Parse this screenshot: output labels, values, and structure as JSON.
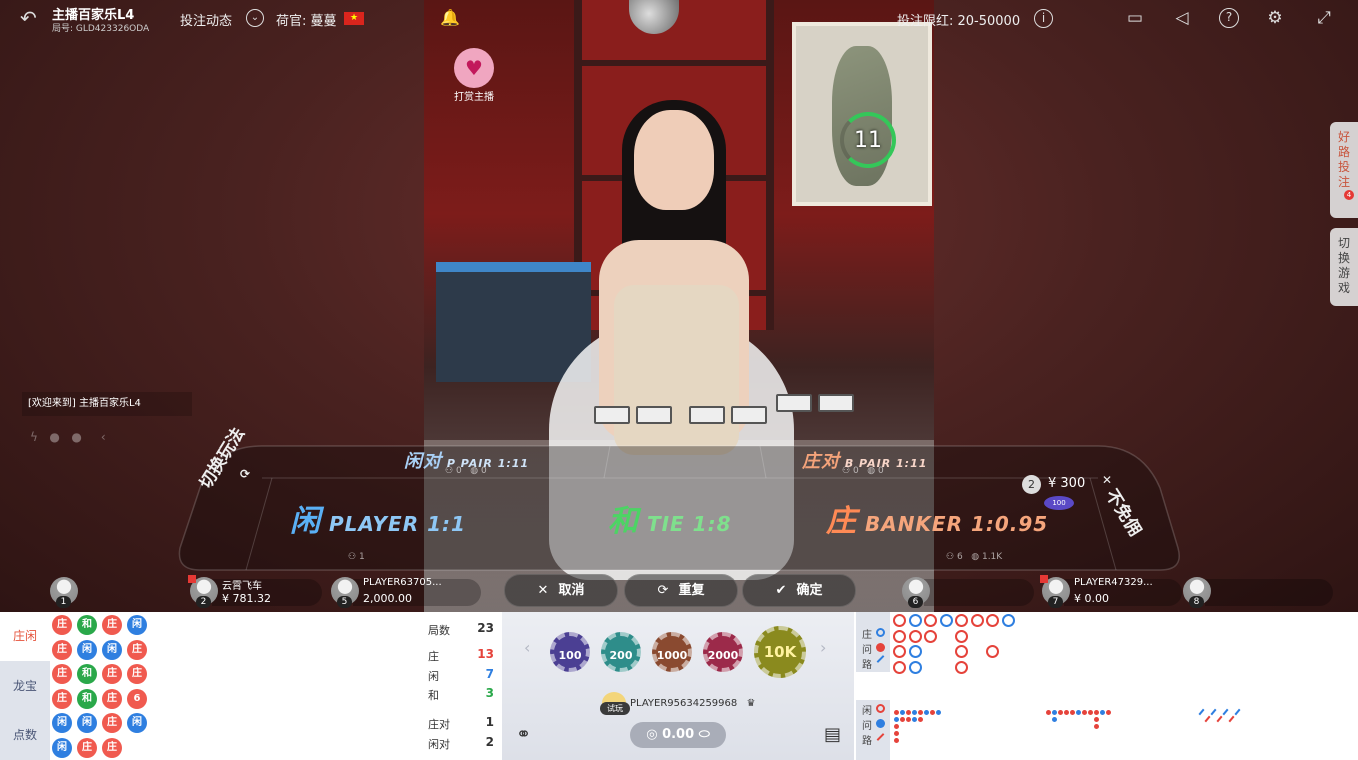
{
  "header": {
    "title": "主播百家乐L4",
    "round_id": "局号: GLD423326ODA",
    "bet_feed": "投注动态",
    "dealer": "荷官: 蔓蔓",
    "bet_limit": "投注限红: 20-50000"
  },
  "tip_anchor": {
    "label": "打赏主播"
  },
  "timer": {
    "value": "11"
  },
  "side_buttons": {
    "good_road": "好路投注",
    "good_road_badge": "4",
    "switch_game": "切换游戏"
  },
  "welcome": "[欢迎来到] 主播百家乐L4",
  "table": {
    "player_pair": "闲对",
    "player_pair_odds": "P PAIR 1:11",
    "banker_pair": "庄对",
    "banker_pair_odds": "B PAIR 1:11",
    "player": "闲",
    "player_odds": "PLAYER 1:1",
    "tie": "和",
    "tie_odds": "TIE 1:8",
    "banker": "庄",
    "banker_odds": "BANKER 1:0.95",
    "switch_mode": "切换玩法",
    "no_commission": "不免佣",
    "pp_count_a": "0",
    "pp_count_b": "0",
    "bp_count_a": "0",
    "bp_count_b": "0",
    "player_count_a": "1",
    "banker_count_a": "6",
    "banker_amount": "1.1K"
  },
  "table_bet": {
    "badge": "2",
    "amount": "¥ 300",
    "chip": "100"
  },
  "seats": [
    {
      "num": "1",
      "name": "",
      "balance": ""
    },
    {
      "num": "2",
      "name": "云霄飞车",
      "balance": "¥ 781.32"
    },
    {
      "num": "5",
      "name": "PLAYER63705...",
      "balance": "2,000.00"
    },
    {
      "num": "6",
      "name": "",
      "balance": ""
    },
    {
      "num": "7",
      "name": "PLAYER47329...",
      "balance": "¥ 0.00"
    },
    {
      "num": "8",
      "name": "",
      "balance": ""
    }
  ],
  "actions": {
    "cancel": "取消",
    "repeat": "重复",
    "confirm": "确定"
  },
  "mode_tabs": [
    "庄闲",
    "龙宝",
    "点数"
  ],
  "bead_road": [
    [
      "庄",
      "和",
      "庄",
      "闲"
    ],
    [
      "庄",
      "闲",
      "闲",
      "庄"
    ],
    [
      "庄",
      "和",
      "庄",
      "庄"
    ],
    [
      "庄",
      "和",
      "庄",
      "6"
    ],
    [
      "闲",
      "闲",
      "庄",
      "闲"
    ],
    [
      "闲",
      "庄",
      "庄"
    ]
  ],
  "stats": {
    "rounds_label": "局数",
    "rounds": "23",
    "banker_label": "庄",
    "banker": "13",
    "player_label": "闲",
    "player": "7",
    "tie_label": "和",
    "tie": "3",
    "bpair_label": "庄对",
    "bpair": "1",
    "ppair_label": "闲对",
    "ppair": "2"
  },
  "chips": [
    "100",
    "200",
    "1000",
    "2000",
    "10K"
  ],
  "user": {
    "tag": "试玩",
    "name": "PLAYER95634259968",
    "balance": "0.00"
  },
  "road_legend": {
    "banker": "庄",
    "player": "闲",
    "ask": "问",
    "road": "路"
  },
  "colors": {
    "banker": "#f05a4f",
    "player": "#2f7fe0",
    "tie": "#2aa84a",
    "accent": "#e5533b"
  }
}
